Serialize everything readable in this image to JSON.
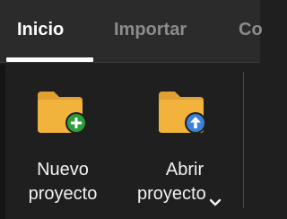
{
  "tabs": [
    {
      "label": "Inicio",
      "active": true
    },
    {
      "label": "Importar",
      "active": false
    },
    {
      "label": "Co",
      "active": false
    }
  ],
  "commands": {
    "new_project": {
      "line1": "Nuevo",
      "line2": "proyecto",
      "icon": "folder-add-icon"
    },
    "open_project": {
      "line1": "Abrir",
      "line2": "proyecto",
      "icon": "folder-upload-icon",
      "has_dropdown": true
    }
  },
  "colors": {
    "tabbar_bg": "#2b2b2b",
    "ribbon_bg": "#1f1f1f",
    "folder": "#f2b33d",
    "add_badge": "#2e9e3a",
    "open_badge": "#3b82d6",
    "active_tab_text": "#ffffff",
    "inactive_tab_text": "#8c8c8c"
  }
}
